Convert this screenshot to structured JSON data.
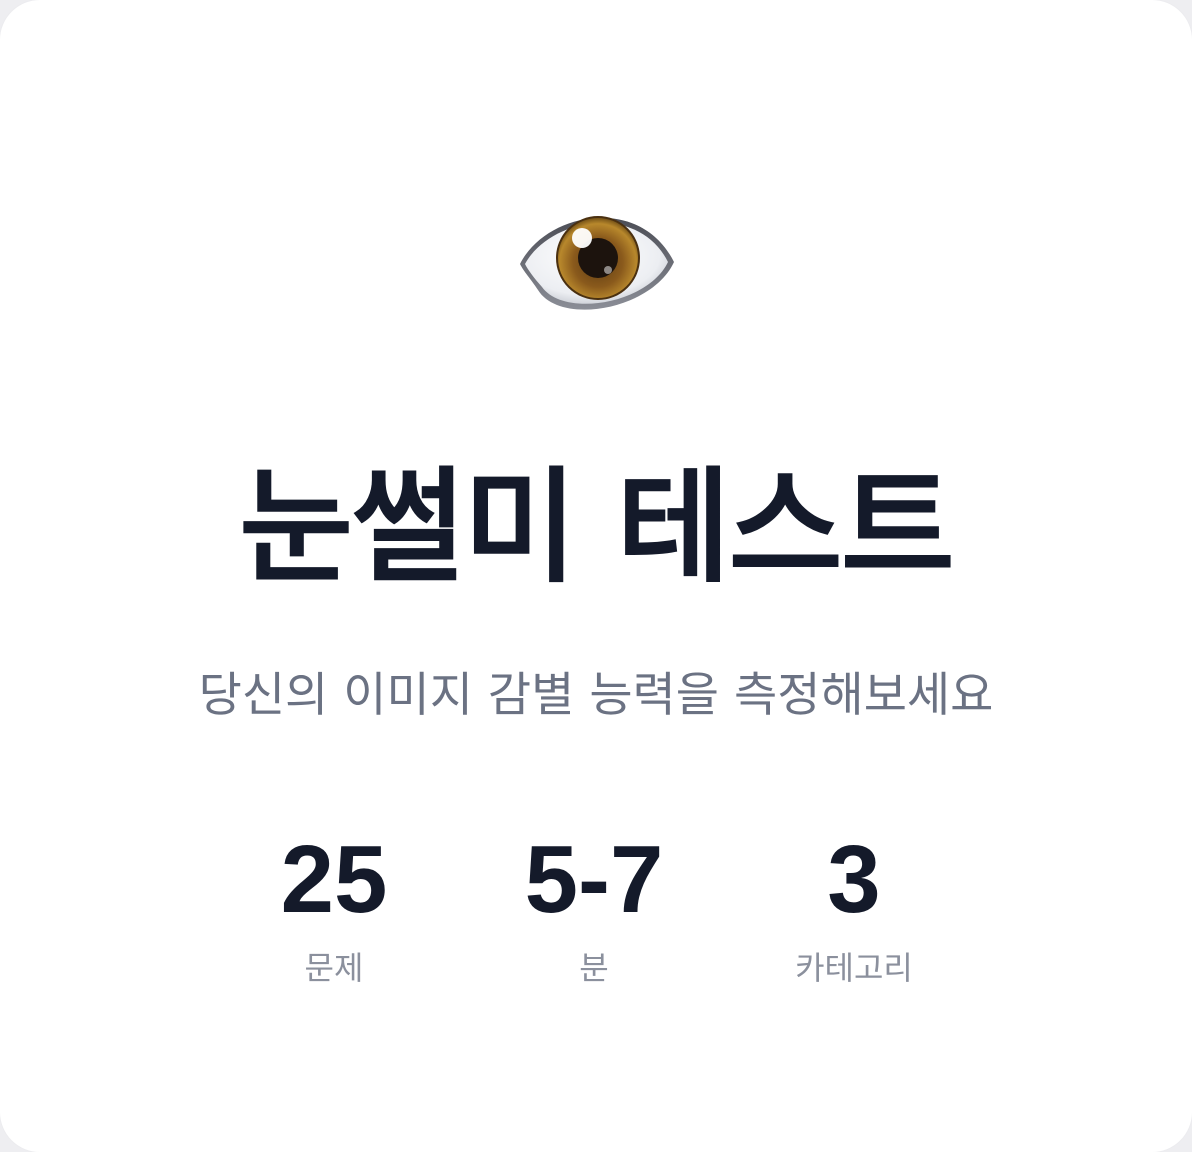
{
  "hero": {
    "icon": "eye-icon",
    "title": "눈썰미 테스트",
    "subtitle": "당신의 이미지 감별 능력을 측정해보세요"
  },
  "stats": [
    {
      "value": "25",
      "label": "문제"
    },
    {
      "value": "5-7",
      "label": "분"
    },
    {
      "value": "3",
      "label": "카테고리"
    }
  ],
  "colors": {
    "title": "#141a2a",
    "subtitle": "#6b7283",
    "stat_label": "#8b909d",
    "card_bg": "#ffffff"
  }
}
